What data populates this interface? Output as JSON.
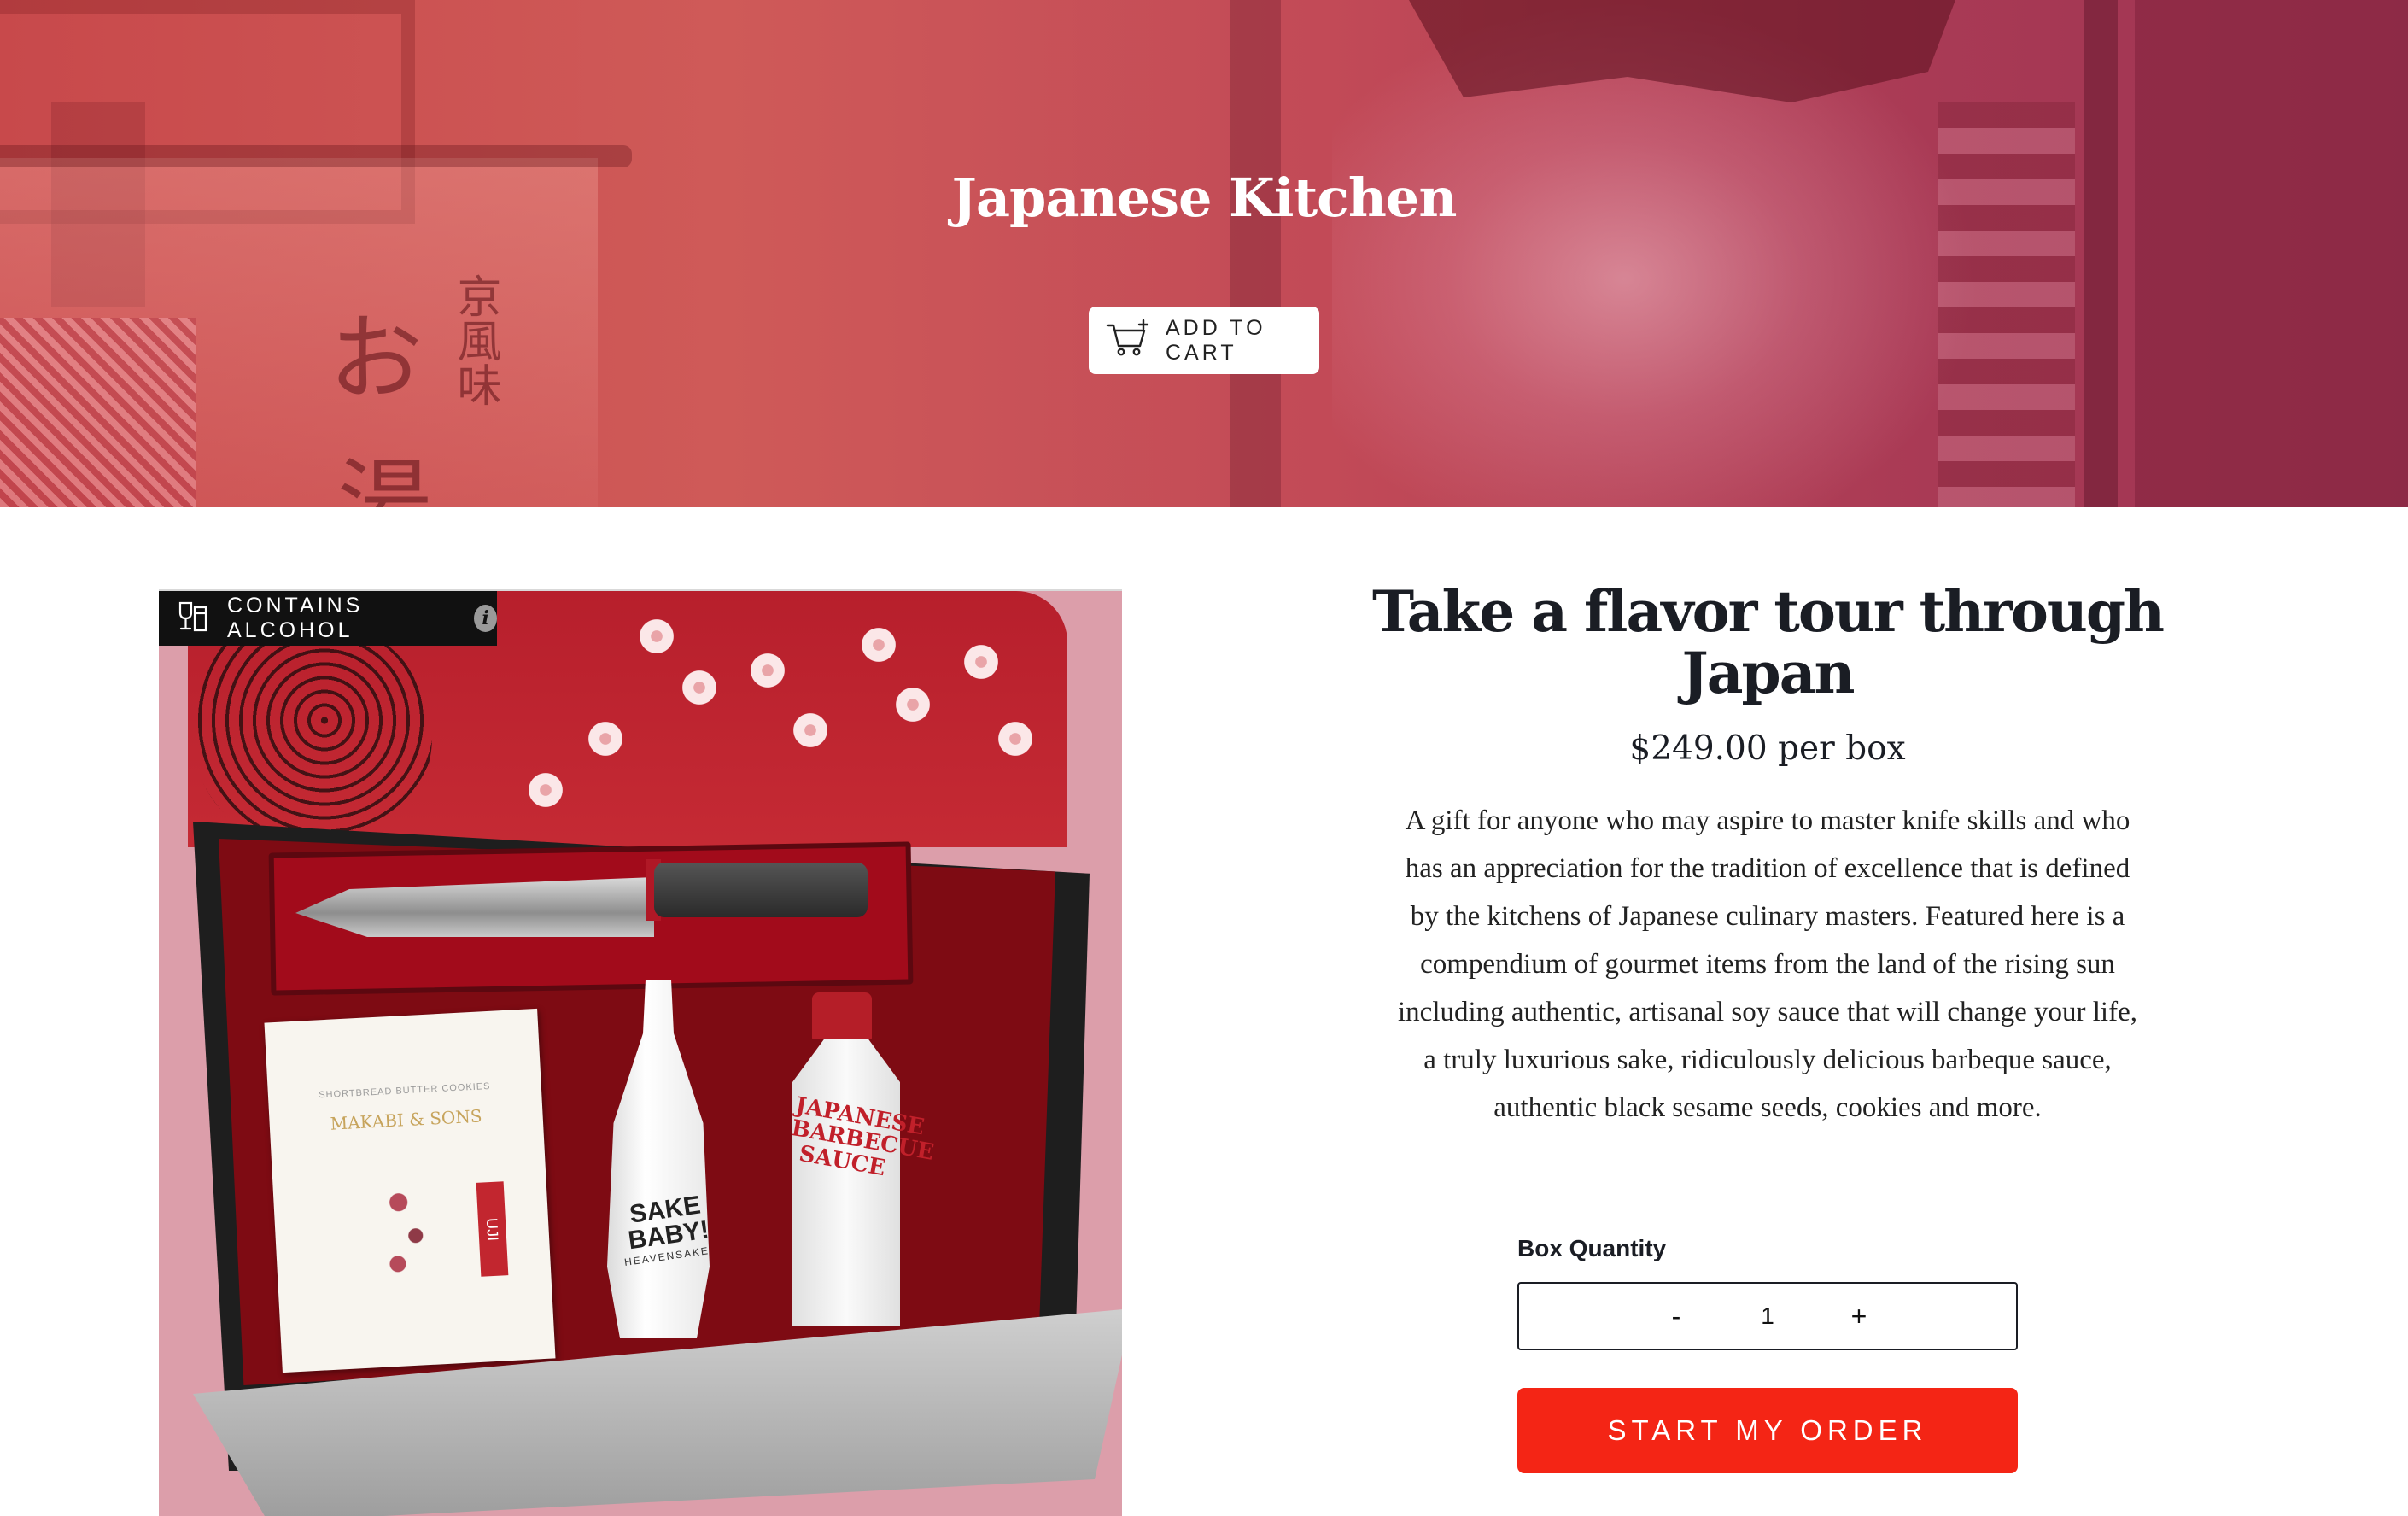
{
  "hero": {
    "title": "Japanese Kitchen",
    "add_to_cart_label": "ADD TO CART",
    "kanji": [
      "お",
      "京風味",
      "湯"
    ]
  },
  "product_image": {
    "badge_label": "CONTAINS ALCOHOL",
    "badge_info": "i",
    "cookie_brand_small": "SHORTBREAD BUTTER COOKIES",
    "cookie_brand": "MAKABI & SONS",
    "cookie_tag": "UJI",
    "sake_label": "SAKE BABY!",
    "sake_sub": "HEAVENSAKE",
    "sauce_label": "JAPANESE BARBECUE SAUCE"
  },
  "product": {
    "title": "Take a flavor tour through Japan",
    "price": "$249.00 per box",
    "description": "A gift for anyone who may aspire to master knife skills and who has an appreciation for the tradition of excellence that is defined by the kitchens of Japanese culinary masters. Featured here is a compendium of gourmet items from the land of the rising sun including authentic, artisanal soy sauce that will change your life, a truly luxurious sake, ridiculously delicious barbeque sauce, authentic black sesame seeds, cookies and more."
  },
  "quantity": {
    "label": "Box Quantity",
    "minus": "-",
    "value": "1",
    "plus": "+"
  },
  "order": {
    "button_label": "START MY ORDER"
  },
  "colors": {
    "cta": "#f42515",
    "hero_tint": "#c8494b",
    "badge_bg": "#111111"
  }
}
